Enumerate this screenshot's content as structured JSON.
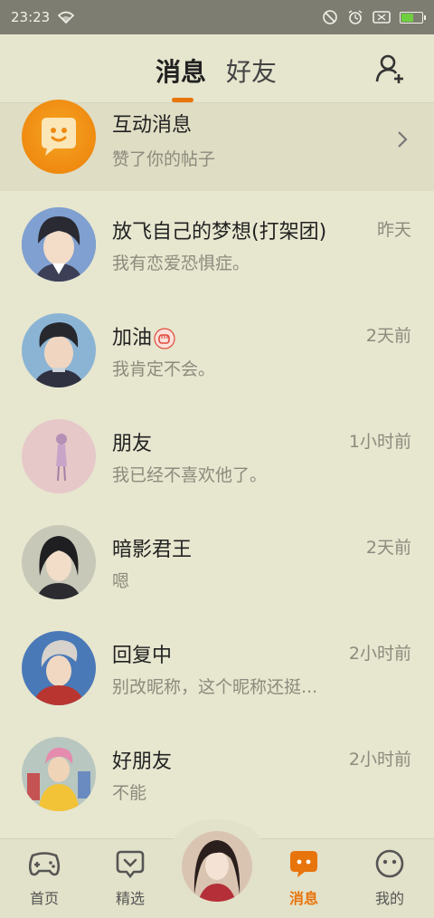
{
  "status_bar": {
    "time": "23:23"
  },
  "header": {
    "tabs": [
      {
        "label": "消息",
        "active": true
      },
      {
        "label": "好友",
        "active": false
      }
    ]
  },
  "interaction": {
    "title": "互动消息",
    "preview": "赞了你的帖子"
  },
  "conversations": [
    {
      "name": "放飞自己的梦想(打架团)",
      "preview": "我有恋爱恐惧症。",
      "time": "昨天"
    },
    {
      "name": "加油",
      "preview": "我肯定不会。",
      "time": "2天前"
    },
    {
      "name": "朋友",
      "preview": "我已经不喜欢他了。",
      "time": "1小时前"
    },
    {
      "name": "暗影君王",
      "preview": "嗯",
      "time": "2天前"
    },
    {
      "name": "回复中",
      "preview": "别改昵称，这个昵称还挺...",
      "time": "2小时前"
    },
    {
      "name": "好朋友",
      "preview": "不能",
      "time": "2小时前"
    }
  ],
  "bottom_nav": [
    {
      "label": "首页",
      "icon": "gamepad-icon"
    },
    {
      "label": "精选",
      "icon": "heart-chat-icon"
    },
    {
      "label": "消息",
      "icon": "message-icon",
      "active": true
    },
    {
      "label": "我的",
      "icon": "smiley-icon"
    }
  ],
  "colors": {
    "accent": "#e8740c",
    "background": "#e7e6cf"
  }
}
